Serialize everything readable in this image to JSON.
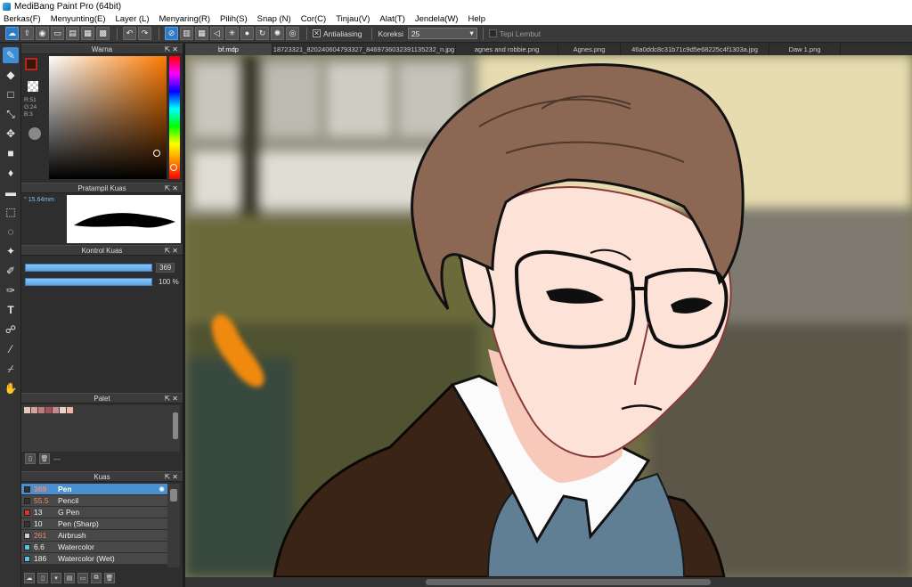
{
  "window": {
    "title": "MediBang Paint Pro (64bit)"
  },
  "menu": [
    "Berkas(F)",
    "Menyunting(E)",
    "Layer (L)",
    "Menyaring(R)",
    "Pilih(S)",
    "Snap (N)",
    "Cor(C)",
    "Tinjau(V)",
    "Alat(T)",
    "Jendela(W)",
    "Help"
  ],
  "toolbar": {
    "antialiasing_label": "Antialiasing",
    "antialiasing_checked": true,
    "correction_label": "Koreksi",
    "correction_value": "25",
    "soft_edge_label": "Tepi Lembut",
    "soft_edge_checked": false
  },
  "panels": {
    "color": {
      "title": "Warna",
      "rgb": [
        "R:51",
        "G:24",
        "B:3"
      ],
      "fg_color": "#331803"
    },
    "brush_preview": {
      "title": "Pratampil Kuas",
      "size": "15.64mm"
    },
    "brush_control": {
      "title": "Kontrol Kuas",
      "size_value": "369",
      "opacity_value": "100 %"
    },
    "palette": {
      "title": "Palet",
      "footer_text": "---",
      "swatches": [
        "#e8c6c0",
        "#d8a39a",
        "#b97f7a",
        "#a15559",
        "#c8888f",
        "#e9d4c9",
        "#f2b5a8"
      ]
    },
    "brushes": {
      "title": "Kuas",
      "items": [
        {
          "size": "369",
          "name": "Pen",
          "color": "#333333",
          "active": true
        },
        {
          "size": "55.5",
          "name": "Pencil",
          "color": "#333333",
          "active": false
        },
        {
          "size": "13",
          "name": "G Pen",
          "color": "#e03030",
          "active": false
        },
        {
          "size": "10",
          "name": "Pen (Sharp)",
          "color": "#333333",
          "active": false
        },
        {
          "size": "261",
          "name": "Airbrush",
          "color": "#cccccc",
          "active": false
        },
        {
          "size": "6.6",
          "name": "Watercolor",
          "color": "#5bc0eb",
          "active": false
        },
        {
          "size": "186",
          "name": "Watercolor (Wet)",
          "color": "#5bc0eb",
          "active": false
        }
      ]
    }
  },
  "tabs": [
    "bf.mdp",
    "18723321_820240604793327_8469736032391135232_n.jpg",
    "agnes and robbie.png",
    "Agnes.png",
    "46a0ddc8c31b71c9d5e68225c4f1303a.jpg",
    "Daw 1.png"
  ],
  "active_tab_index": 0,
  "colors": {
    "accent": "#3d8fd6",
    "panel": "#2e2e2e",
    "toolbar": "#3a3a3a"
  }
}
